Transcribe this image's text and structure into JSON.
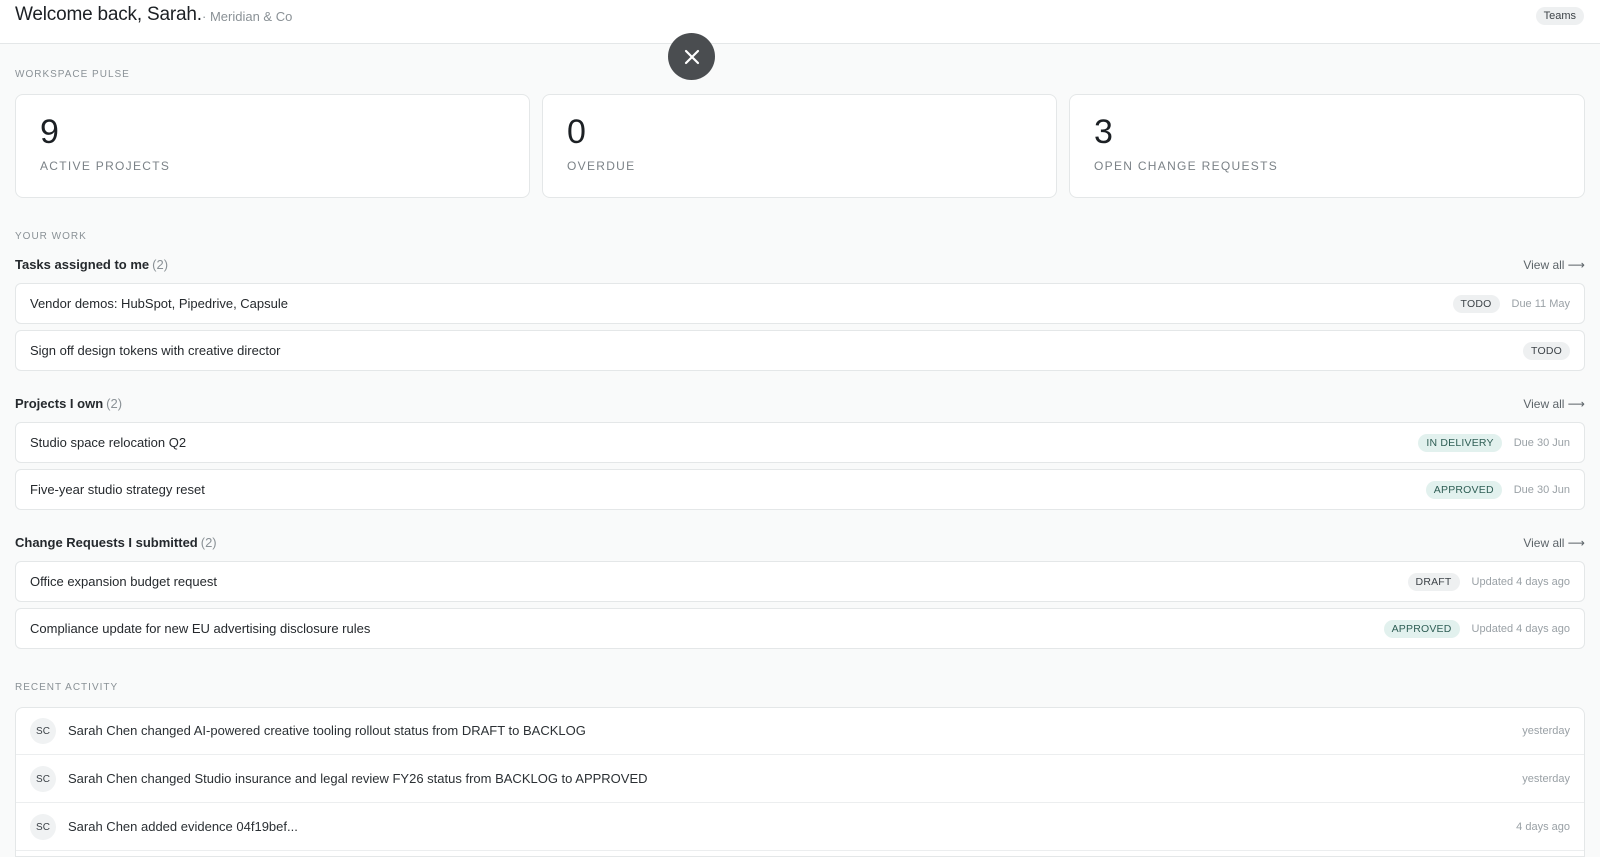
{
  "header": {
    "welcome": "Welcome back, Sarah.",
    "org": "· Meridian & Co",
    "teams_label": "Teams"
  },
  "overlay": {
    "close_icon": "close-icon"
  },
  "pulse": {
    "label": "WORKSPACE PULSE",
    "stats": [
      {
        "value": "9",
        "label": "ACTIVE PROJECTS"
      },
      {
        "value": "0",
        "label": "OVERDUE"
      },
      {
        "value": "3",
        "label": "OPEN CHANGE REQUESTS"
      }
    ]
  },
  "your_work": {
    "label": "YOUR WORK",
    "view_all": "View all ⟶",
    "tasks": {
      "title": "Tasks assigned to me",
      "count": "(2)",
      "items": [
        {
          "title": "Vendor demos: HubSpot, Pipedrive, Capsule",
          "badge": "TODO",
          "meta": "Due 11 May"
        },
        {
          "title": "Sign off design tokens with creative director",
          "badge": "TODO",
          "meta": ""
        }
      ]
    },
    "projects": {
      "title": "Projects I own",
      "count": "(2)",
      "items": [
        {
          "title": "Studio space relocation Q2",
          "badge": "IN DELIVERY",
          "meta": "Due 30 Jun"
        },
        {
          "title": "Five-year studio strategy reset",
          "badge": "APPROVED",
          "meta": "Due 30 Jun"
        }
      ]
    },
    "change_requests": {
      "title": "Change Requests I submitted",
      "count": "(2)",
      "items": [
        {
          "title": "Office expansion budget request",
          "badge": "DRAFT",
          "meta": "Updated 4 days ago"
        },
        {
          "title": "Compliance update for new EU advertising disclosure rules",
          "badge": "APPROVED",
          "meta": "Updated 4 days ago"
        }
      ]
    }
  },
  "recent_activity": {
    "label": "RECENT ACTIVITY",
    "items": [
      {
        "initials": "SC",
        "text": "Sarah Chen changed AI-powered creative tooling rollout status from DRAFT to BACKLOG",
        "time": "yesterday"
      },
      {
        "initials": "SC",
        "text": "Sarah Chen changed Studio insurance and legal review FY26 status from BACKLOG to APPROVED",
        "time": "yesterday"
      },
      {
        "initials": "SC",
        "text": "Sarah Chen added evidence 04f19bef...",
        "time": "4 days ago"
      }
    ]
  },
  "colors": {
    "background": "#f9fafa",
    "card": "#ffffff",
    "border": "#e4e7e8",
    "approved_badge": "#e2f1ee",
    "neutral_badge": "#eef0f1",
    "fab": "#4a4d50"
  }
}
